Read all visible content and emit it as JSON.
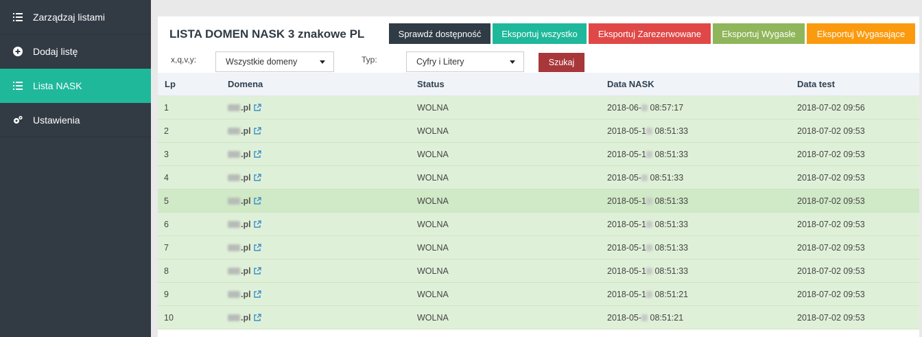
{
  "sidebar": {
    "items": [
      {
        "label": "Zarządzaj listami",
        "icon": "list-icon"
      },
      {
        "label": "Dodaj listę",
        "icon": "plus-circle-icon"
      },
      {
        "label": "Lista NASK",
        "icon": "list-icon",
        "active": true
      },
      {
        "label": "Ustawienia",
        "icon": "gears-icon"
      }
    ]
  },
  "header": {
    "title": "LISTA DOMEN NASK 3 znakowe PL",
    "buttons": [
      {
        "label": "Sprawdź dostępność",
        "color": "#2f3b45"
      },
      {
        "label": "Eksportuj wszystko",
        "color": "#1fb89b"
      },
      {
        "label": "Eksportuj Zarezerwowane",
        "color": "#e04848"
      },
      {
        "label": "Eksportuj Wygasłe",
        "color": "#8fb65a"
      },
      {
        "label": "Eksportuj Wygasające",
        "color": "#fb9a0e"
      }
    ]
  },
  "filters": {
    "label1": "x,q,v,y:",
    "select1": "Wszystkie domeny",
    "label2": "Typ:",
    "select2": "Cyfry i Litery",
    "search_label": "Szukaj"
  },
  "table": {
    "headers": {
      "lp": "Lp",
      "domain": "Domena",
      "status": "Status",
      "nask": "Data NASK",
      "test": "Data test"
    },
    "rows": [
      {
        "lp": "1",
        "domain": ".pl",
        "status": "WOLNA",
        "nask_a": "2018-06-",
        "nask_b": " 08:57:17",
        "test": "2018-07-02 09:56"
      },
      {
        "lp": "2",
        "domain": ".pl",
        "status": "WOLNA",
        "nask_a": "2018-05-1",
        "nask_b": " 08:51:33",
        "test": "2018-07-02 09:53"
      },
      {
        "lp": "3",
        "domain": ".pl",
        "status": "WOLNA",
        "nask_a": "2018-05-1",
        "nask_b": " 08:51:33",
        "test": "2018-07-02 09:53"
      },
      {
        "lp": "4",
        "domain": ".pl",
        "status": "WOLNA",
        "nask_a": "2018-05-",
        "nask_b": " 08:51:33",
        "test": "2018-07-02 09:53"
      },
      {
        "lp": "5",
        "domain": ".pl",
        "status": "WOLNA",
        "nask_a": "2018-05-1",
        "nask_b": " 08:51:33",
        "test": "2018-07-02 09:53"
      },
      {
        "lp": "6",
        "domain": ".pl",
        "status": "WOLNA",
        "nask_a": "2018-05-1",
        "nask_b": " 08:51:33",
        "test": "2018-07-02 09:53"
      },
      {
        "lp": "7",
        "domain": ".pl",
        "status": "WOLNA",
        "nask_a": "2018-05-1",
        "nask_b": " 08:51:33",
        "test": "2018-07-02 09:53"
      },
      {
        "lp": "8",
        "domain": ".pl",
        "status": "WOLNA",
        "nask_a": "2018-05-1",
        "nask_b": " 08:51:33",
        "test": "2018-07-02 09:53"
      },
      {
        "lp": "9",
        "domain": ".pl",
        "status": "WOLNA",
        "nask_a": "2018-05-1",
        "nask_b": " 08:51:21",
        "test": "2018-07-02 09:53"
      },
      {
        "lp": "10",
        "domain": ".pl",
        "status": "WOLNA",
        "nask_a": "2018-05-",
        "nask_b": " 08:51:21",
        "test": "2018-07-02 09:53"
      }
    ]
  }
}
